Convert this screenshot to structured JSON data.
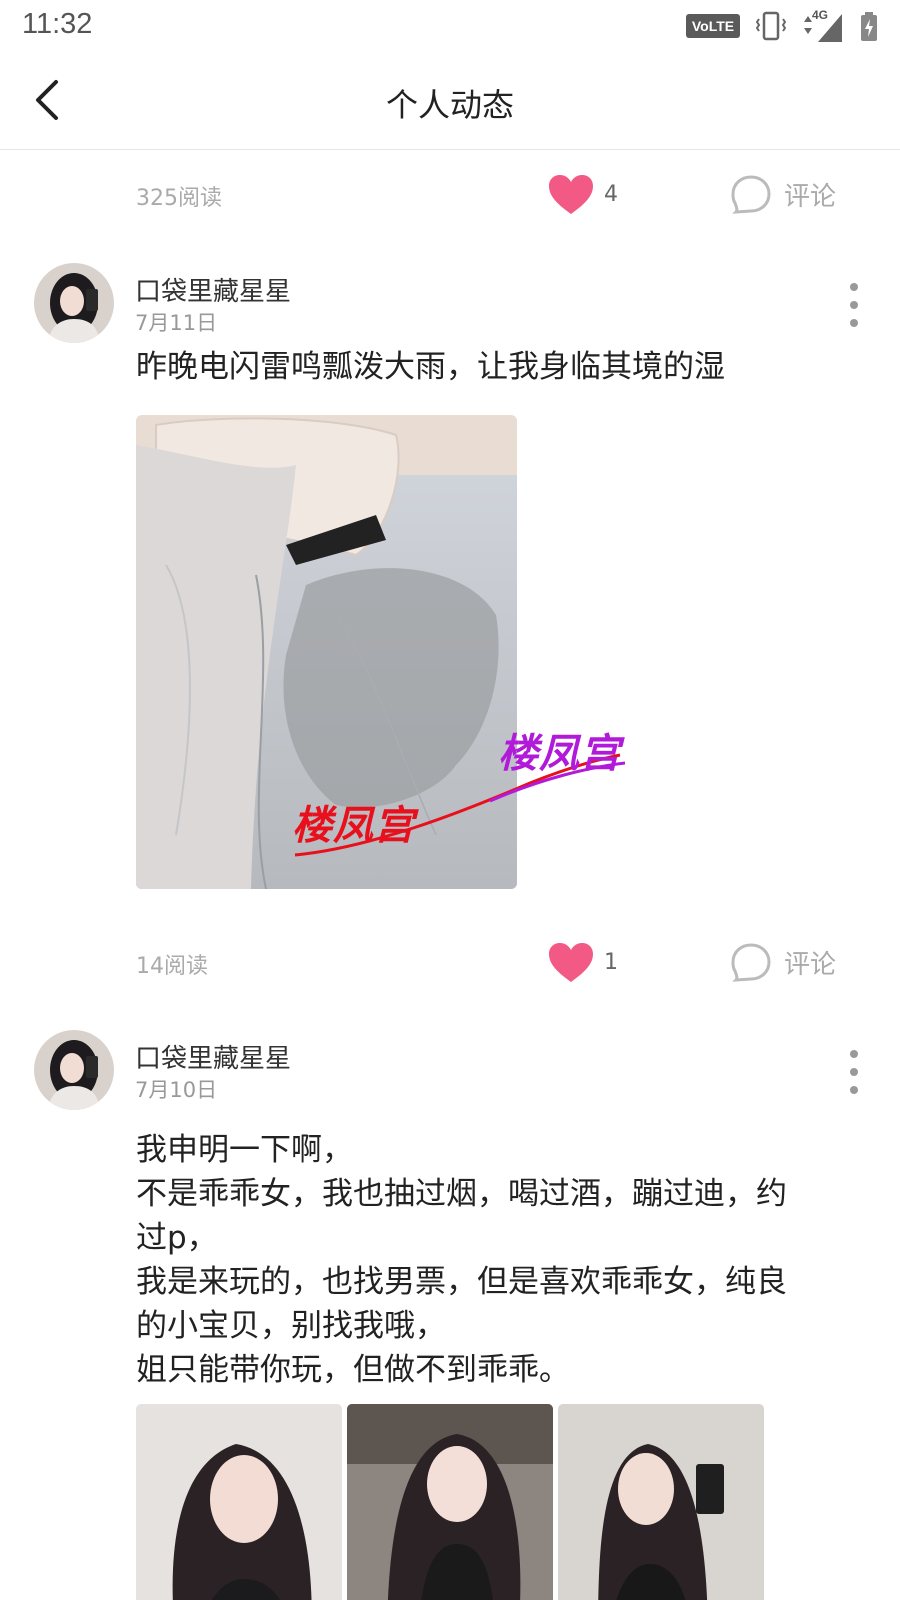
{
  "status_bar": {
    "time": "11:32",
    "volte": "VoLTE",
    "network": "4G",
    "icons": [
      "vibrate-icon",
      "signal-icon",
      "battery-icon"
    ]
  },
  "nav": {
    "title": "个人动态",
    "back_icon": "chevron-left-icon"
  },
  "stats": [
    {
      "reads": "325阅读",
      "likes": "4",
      "comment_label": "评论"
    },
    {
      "reads": "14阅读",
      "likes": "1",
      "comment_label": "评论"
    }
  ],
  "posts": [
    {
      "username": "口袋里藏星星",
      "date": "7月11日",
      "lines": [
        "昨晚电闪雷鸣瓢泼大雨，让我身临其境的湿"
      ],
      "watermarks": [
        "楼凤宫",
        "楼凤宫"
      ]
    },
    {
      "username": "口袋里藏星星",
      "date": "7月10日",
      "lines": [
        "我申明一下啊，",
        "不是乖乖女，我也抽过烟，喝过酒，蹦过迪，约",
        "过p，",
        "我是来玩的，也找男票，但是喜欢乖乖女，纯良",
        "的小宝贝，别找我哦，",
        "姐只能带你玩，但做不到乖乖。"
      ]
    }
  ],
  "colors": {
    "heart": "#f25a85",
    "watermark_red": "#e8101c",
    "watermark_purple": "#b11ad8",
    "muted_text": "#aaaaaa"
  }
}
